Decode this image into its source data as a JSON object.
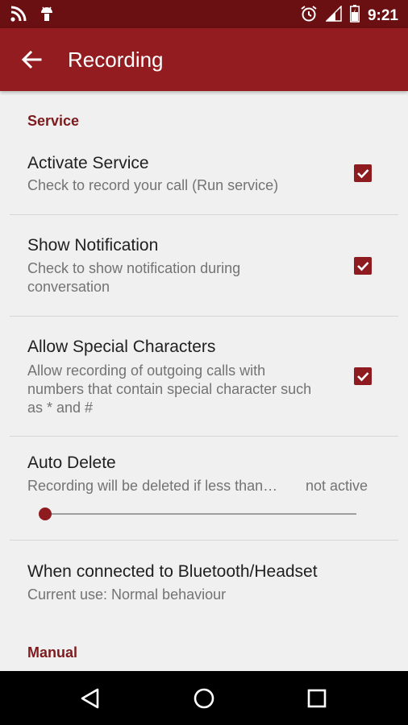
{
  "statusbar": {
    "time": "9:21",
    "icons": [
      "rss-icon",
      "android-debug-icon",
      "alarm-clock-icon",
      "signal-icon",
      "battery-icon"
    ]
  },
  "appbar": {
    "title": "Recording",
    "back_icon": "arrow-back-icon"
  },
  "sections": {
    "service_header": "Service",
    "manual_header": "Manual"
  },
  "prefs": {
    "activate_service": {
      "title": "Activate Service",
      "summary": "Check to record your call (Run service)",
      "checked": true
    },
    "show_notification": {
      "title": "Show Notification",
      "summary": "Check to show notification during conversation",
      "checked": true
    },
    "allow_special": {
      "title": "Allow Special Characters",
      "summary": "Allow recording of outgoing calls with numbers that contain special character such as * and #",
      "checked": true
    },
    "auto_delete": {
      "title": "Auto Delete",
      "summary": "Recording will be deleted if less than…",
      "status": "not active",
      "slider_value": 0
    },
    "bluetooth": {
      "title": "When connected to Bluetooth/Headset",
      "summary": "Current use: Normal behaviour"
    }
  },
  "colors": {
    "statusbar": "#6a0f12",
    "appbar": "#931c21",
    "accent": "#8e1b20",
    "section_header": "#7d1b1e",
    "background": "#f0f0f0"
  },
  "navbar": {
    "icons": [
      "back-triangle-icon",
      "home-circle-icon",
      "recents-square-icon"
    ]
  }
}
